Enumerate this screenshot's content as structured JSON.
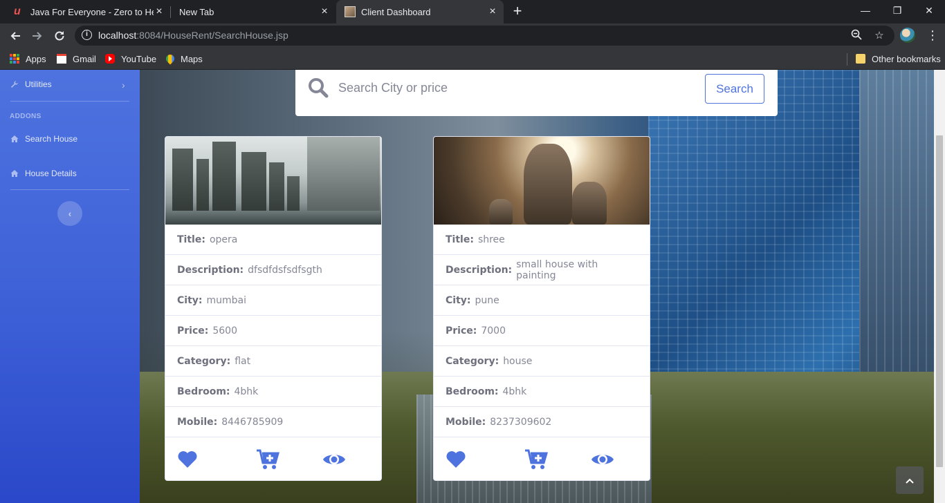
{
  "browser": {
    "tabs": [
      {
        "title": "Java For Everyone - Zero to Hero"
      },
      {
        "title": "New Tab"
      },
      {
        "title": "Client Dashboard"
      }
    ],
    "url": {
      "host": "localhost",
      "rest": ":8084/HouseRent/SearchHouse.jsp"
    },
    "bookmarks": [
      {
        "label": "Apps"
      },
      {
        "label": "Gmail"
      },
      {
        "label": "YouTube"
      },
      {
        "label": "Maps"
      }
    ],
    "other_bookmarks": "Other bookmarks"
  },
  "sidebar": {
    "utilities": "Utilities",
    "heading": "ADDONS",
    "items": [
      {
        "label": "Search House"
      },
      {
        "label": "House Details"
      }
    ]
  },
  "search": {
    "placeholder": "Search City or price",
    "button": "Search"
  },
  "field_labels": {
    "title": "Title:",
    "description": "Description:",
    "city": "City:",
    "price": "Price:",
    "category": "Category:",
    "bedroom": "Bedroom:",
    "mobile": "Mobile:"
  },
  "houses": [
    {
      "title": "opera",
      "description": "dfsdfdsfsdfsgth",
      "city": "mumbai",
      "price": "5600",
      "category": "flat",
      "bedroom": "4bhk",
      "mobile": "8446785909"
    },
    {
      "title": "shree",
      "description": "small house with painting",
      "city": "pune",
      "price": "7000",
      "category": "house",
      "bedroom": "4bhk",
      "mobile": "8237309602"
    }
  ],
  "colors": {
    "accent": "#4e73df",
    "sidebar_top": "#4e73df",
    "sidebar_bottom": "#2a48c9"
  }
}
